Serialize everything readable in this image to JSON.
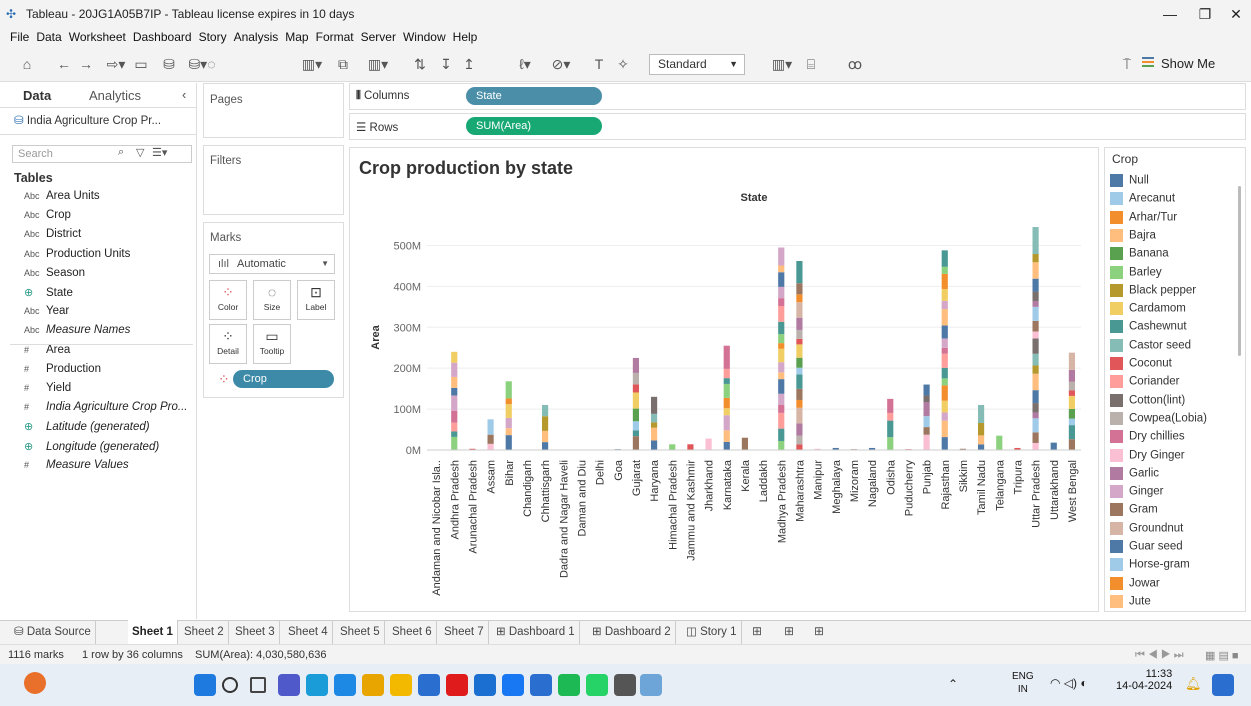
{
  "window": {
    "title": "Tableau - 20JG1A05B7IP - Tableau license expires in 10 days"
  },
  "menu": [
    "File",
    "Data",
    "Worksheet",
    "Dashboard",
    "Story",
    "Analysis",
    "Map",
    "Format",
    "Server",
    "Window",
    "Help"
  ],
  "toolbar": {
    "fit": "Standard",
    "show_me": "Show Me"
  },
  "data_pane": {
    "tabs": [
      "Data",
      "Analytics"
    ],
    "source": "India Agriculture Crop Pr...",
    "search_placeholder": "Search",
    "tables_label": "Tables",
    "fields": [
      {
        "type": "Abc",
        "name": "Area Units"
      },
      {
        "type": "Abc",
        "name": "Crop"
      },
      {
        "type": "Abc",
        "name": "District"
      },
      {
        "type": "Abc",
        "name": "Production Units"
      },
      {
        "type": "Abc",
        "name": "Season"
      },
      {
        "type": "geo",
        "name": "State"
      },
      {
        "type": "Abc",
        "name": "Year"
      },
      {
        "type": "Abc",
        "name": "Measure Names"
      },
      {
        "type": "#",
        "name": "Area"
      },
      {
        "type": "#",
        "name": "Production"
      },
      {
        "type": "#",
        "name": "Yield"
      },
      {
        "type": "#",
        "name": "India Agriculture Crop Pro..."
      },
      {
        "type": "geo",
        "name": "Latitude (generated)"
      },
      {
        "type": "geo",
        "name": "Longitude (generated)"
      },
      {
        "type": "#",
        "name": "Measure Values"
      }
    ]
  },
  "cards": {
    "pages": "Pages",
    "filters": "Filters",
    "marks": "Marks",
    "mark_type": "Automatic",
    "buttons": [
      "Color",
      "Size",
      "Label",
      "Detail",
      "Tooltip"
    ],
    "color_pill": "Crop"
  },
  "shelves": {
    "columns_label": "Columns",
    "columns_pill": "State",
    "rows_label": "Rows",
    "rows_pill": "SUM(Area)"
  },
  "chart_data": {
    "type": "bar",
    "title": "Crop production by state",
    "header": "State",
    "ylabel": "Area",
    "ylim": [
      0,
      550
    ],
    "yticks": [
      "0M",
      "100M",
      "200M",
      "300M",
      "400M",
      "500M"
    ],
    "categories": [
      "Andaman and Nicobar Isla..",
      "Andhra Pradesh",
      "Arunachal Pradesh",
      "Assam",
      "Bihar",
      "Chandigarh",
      "Chhattisgarh",
      "Dadra and Nagar Haveli",
      "Daman and Diu",
      "Delhi",
      "Goa",
      "Gujarat",
      "Haryana",
      "Himachal Pradesh",
      "Jammu and Kashmir",
      "Jharkhand",
      "Karnataka",
      "Kerala",
      "Laddakh",
      "Madhya Pradesh",
      "Maharashtra",
      "Manipur",
      "Meghalaya",
      "Mizoram",
      "Nagaland",
      "Odisha",
      "Puducherry",
      "Punjab",
      "Rajasthan",
      "Sikkim",
      "Tamil Nadu",
      "Telangana",
      "Tripura",
      "Uttar Pradesh",
      "Uttarakhand",
      "West Bengal"
    ],
    "values": [
      1,
      240,
      3,
      75,
      168,
      0,
      110,
      1,
      0,
      0,
      2,
      225,
      130,
      14,
      14,
      28,
      255,
      30,
      1,
      495,
      462,
      3,
      5,
      2,
      5,
      125,
      2,
      160,
      488,
      3,
      110,
      35,
      5,
      545,
      18,
      238
    ]
  },
  "legend": {
    "title": "Crop",
    "items": [
      {
        "name": "Null",
        "color": "#4e79a7"
      },
      {
        "name": "Arecanut",
        "color": "#a0cbe8"
      },
      {
        "name": "Arhar/Tur",
        "color": "#f28e2b"
      },
      {
        "name": "Bajra",
        "color": "#ffbe7d"
      },
      {
        "name": "Banana",
        "color": "#59a14f"
      },
      {
        "name": "Barley",
        "color": "#8cd17d"
      },
      {
        "name": "Black pepper",
        "color": "#b6992d"
      },
      {
        "name": "Cardamom",
        "color": "#f1ce63"
      },
      {
        "name": "Cashewnut",
        "color": "#499894"
      },
      {
        "name": "Castor seed",
        "color": "#86bcb6"
      },
      {
        "name": "Coconut",
        "color": "#e15759"
      },
      {
        "name": "Coriander",
        "color": "#ff9d9a"
      },
      {
        "name": "Cotton(lint)",
        "color": "#79706e"
      },
      {
        "name": "Cowpea(Lobia)",
        "color": "#bab0ac"
      },
      {
        "name": "Dry chillies",
        "color": "#d37295"
      },
      {
        "name": "Dry Ginger",
        "color": "#fabfd2"
      },
      {
        "name": "Garlic",
        "color": "#b07aa1"
      },
      {
        "name": "Ginger",
        "color": "#d4a6c8"
      },
      {
        "name": "Gram",
        "color": "#9d7660"
      },
      {
        "name": "Groundnut",
        "color": "#d7b5a6"
      },
      {
        "name": "Guar seed",
        "color": "#4e79a7"
      },
      {
        "name": "Horse-gram",
        "color": "#a0cbe8"
      },
      {
        "name": "Jowar",
        "color": "#f28e2b"
      },
      {
        "name": "Jute",
        "color": "#ffbe7d"
      }
    ]
  },
  "sheets": {
    "data_source": "Data Source",
    "tabs": [
      "Sheet 1",
      "Sheet 2",
      "Sheet 3",
      "Sheet 4",
      "Sheet 5",
      "Sheet 6",
      "Sheet 7",
      "Dashboard 1",
      "Dashboard 2",
      "Story 1"
    ]
  },
  "status": {
    "marks": "1116 marks",
    "dims": "1 row by 36 columns",
    "sum": "SUM(Area): 4,030,580,636"
  },
  "taskbar": {
    "lang": "ENG",
    "region": "IN",
    "time": "11:33",
    "date": "14-04-2024"
  }
}
